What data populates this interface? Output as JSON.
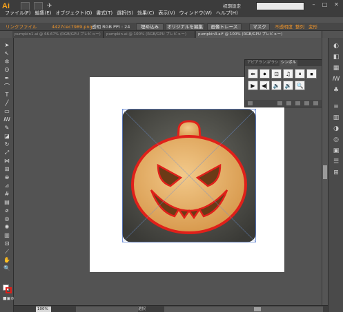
{
  "app": {
    "logo": "Ai",
    "workspace": "初期設定",
    "menu": [
      "ファイル(F)",
      "編集(E)",
      "オブジェクト(O)",
      "書式(T)",
      "選択(S)",
      "効果(C)",
      "表示(V)",
      "ウィンドウ(W)",
      "ヘルプ(H)"
    ]
  },
  "controlbar": {
    "link_label": "リンクファイル",
    "filename": "4427cec7989.png",
    "mode": "透明 RGB",
    "ppi": "PPI : 24",
    "embed_btn": "埋め込み",
    "edit_original_btn": "オリジナルを編集",
    "live_trace_btn": "画像トレース",
    "mask_btn": "マスク",
    "opacity_label": "不透明度",
    "align_label": "整列",
    "transform_label": "変形"
  },
  "tabs": [
    {
      "label": "pumpkin1.ai @ 66.67% (RGB/GPU プレビュー)",
      "active": false
    },
    {
      "label": "pumpkin.ai @ 100% (RGB/GPU プレビュー)",
      "active": false
    },
    {
      "label": "pumpkin3.ai* @ 100% (RGB/GPU プレビュー)",
      "active": true
    }
  ],
  "symbol_panel": {
    "tabs": [
      "アピアランス",
      "ブラシ",
      "シンボル"
    ],
    "active_tab": "シンボル",
    "symbols": [
      "⬅",
      "⏺",
      "⊡",
      "♫",
      "⏸",
      "⏹",
      "▶",
      "◀|",
      "🔈",
      "🔉",
      "🔍"
    ]
  },
  "status": {
    "zoom": "100%",
    "mode": "選択"
  },
  "colors": {
    "accent": "#f0952b",
    "stroke": "#e0201a",
    "fill": "#ffffff"
  }
}
